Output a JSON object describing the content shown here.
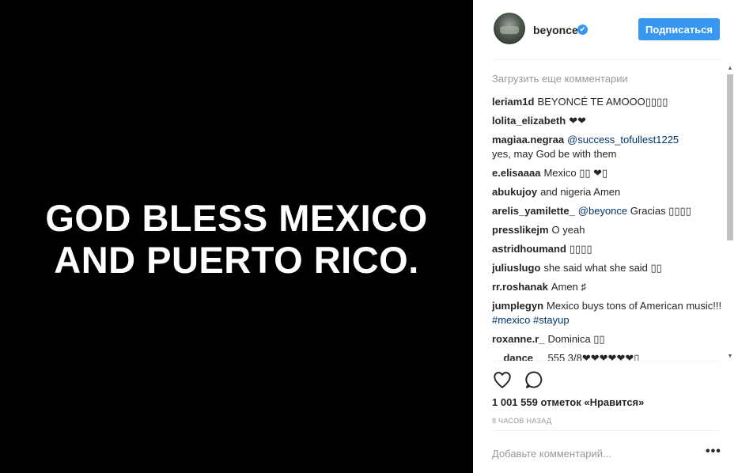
{
  "photo": {
    "line1": "GOD BLESS MEXICO",
    "line2": "AND PUERTO RICO."
  },
  "header": {
    "username": "beyonce",
    "verified_mark": "✔",
    "follow_label": "Подписаться"
  },
  "comments": {
    "load_more": "Загрузить еще комментарии",
    "items": [
      {
        "user": "leriam1d",
        "text": "BEYONCÉ TE AMOOO▯▯▯▯"
      },
      {
        "user": "lolita_elizabeth",
        "text": "❤❤"
      },
      {
        "user": "magiaa.negraa",
        "mention": "@success_tofullest1225",
        "text": "yes, may God be with them"
      },
      {
        "user": "e.elisaaaa",
        "text": "Mexico ▯▯ ❤▯"
      },
      {
        "user": "abukujoy",
        "text": "and nigeria Amen"
      },
      {
        "user": "arelis_yamilette_",
        "mention": "@beyonce",
        "text": "Gracias ▯▯▯▯"
      },
      {
        "user": "presslikejm",
        "text": "O yeah"
      },
      {
        "user": "astridhoumand",
        "text": "▯▯▯▯"
      },
      {
        "user": "juliuslugo",
        "text": "she said what she said ▯▯"
      },
      {
        "user": "rr.roshanak",
        "text": "Amen ♯"
      },
      {
        "user": "jumplegyn",
        "text": "Mexico buys tons of American music!!!",
        "tags": "#mexico #stayup"
      },
      {
        "user": "roxanne.r_",
        "text": "Dominica ▯▯"
      },
      {
        "user": "__dance__",
        "text": "555 3/8❤❤❤❤❤❤▯"
      }
    ]
  },
  "actions": {
    "like_icon": "heart-icon",
    "comment_icon": "speech-bubble-icon",
    "likes_text": "1 001 559 отметок «Нравится»",
    "time_text": "8 часов назад"
  },
  "add_comment": {
    "placeholder": "Добавьте комментарий...",
    "more_label": "•••"
  },
  "colors": {
    "accent": "#3897f0",
    "mention": "#003569",
    "muted": "#999999"
  }
}
